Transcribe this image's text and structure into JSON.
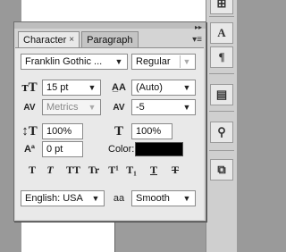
{
  "tabs": [
    {
      "label": "Character",
      "close": "×"
    },
    {
      "label": "Paragraph"
    }
  ],
  "font": {
    "family": "Franklin Gothic ...",
    "style": "Regular"
  },
  "size": {
    "value": "15 pt"
  },
  "leading": {
    "value": "(Auto)"
  },
  "kerning": {
    "value": "Metrics"
  },
  "tracking": {
    "value": "-5"
  },
  "vscale": {
    "value": "100%"
  },
  "hscale": {
    "value": "100%"
  },
  "baseline": {
    "value": "0 pt"
  },
  "color": {
    "label": "Color:",
    "value": "#000000"
  },
  "type_styles": [
    "T",
    "T",
    "TT",
    "Tr",
    "T¹",
    "T₁",
    "T",
    "T"
  ],
  "language": {
    "value": "English: USA"
  },
  "antialias": {
    "icon": "aa",
    "value": "Smooth"
  },
  "icons": {
    "size": "font-size-icon",
    "leading": "leading-icon",
    "kerning": "kerning-icon",
    "tracking": "tracking-icon",
    "vscale": "vertical-scale-icon",
    "hscale": "horizontal-scale-icon",
    "baseline": "baseline-shift-icon"
  }
}
